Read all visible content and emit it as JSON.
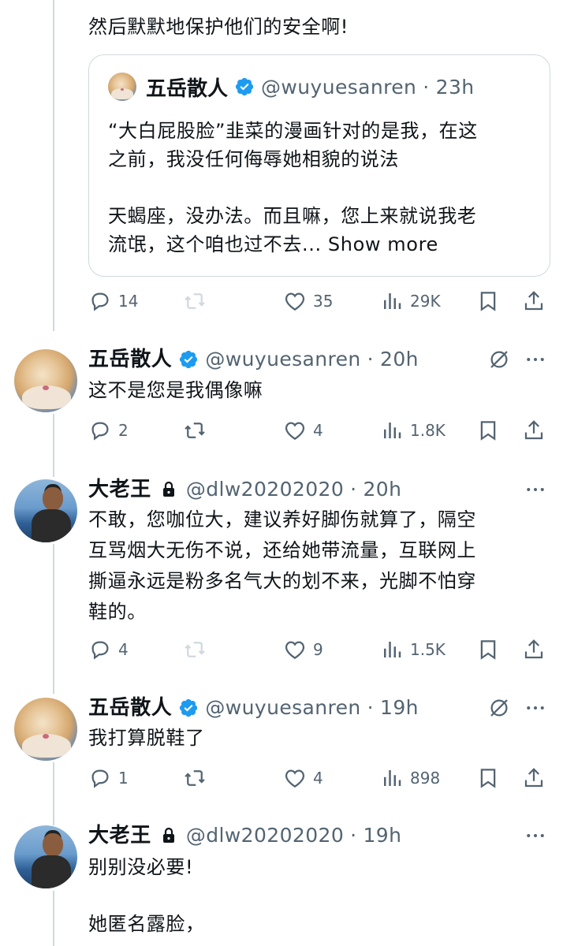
{
  "post0": {
    "text": "然后默默地保护他们的安全啊!",
    "quote": {
      "name": "五岳散人",
      "handle": "@wuyuesanren",
      "sep": "·",
      "time": "23h",
      "lines": [
        "“大白屁股脸”韭菜的漫画针对的是我，在这",
        "之前，我没任何侮辱她相貌的说法",
        "天蝎座，没办法。而且嘛，您上来就说我老",
        "流氓，这个咱也过不去..."
      ],
      "show_more": "Show more"
    },
    "actions": {
      "replies": "14",
      "retweets": "",
      "likes": "35",
      "views": "29K"
    }
  },
  "replies": [
    {
      "name": "五岳散人",
      "handle": "@wuyuesanren",
      "sep": "·",
      "time": "20h",
      "lines": [
        "这不是您是我偶像嘛"
      ],
      "actions": {
        "replies": "2",
        "retweets": "",
        "likes": "4",
        "views": "1.8K"
      }
    },
    {
      "name": "大老王",
      "handle": "@dlw20202020",
      "sep": "·",
      "time": "20h",
      "lines": [
        "不敢，您咖位大，建议养好脚伤就算了，隔空",
        "互骂烟大无伤不说，还给她带流量，互联网上",
        "撕逼永远是粉多名气大的划不来，光脚不怕穿",
        "鞋的。"
      ],
      "actions": {
        "replies": "4",
        "retweets": "",
        "likes": "9",
        "views": "1.5K"
      }
    },
    {
      "name": "五岳散人",
      "handle": "@wuyuesanren",
      "sep": "·",
      "time": "19h",
      "lines": [
        "我打算脱鞋了"
      ],
      "actions": {
        "replies": "1",
        "retweets": "",
        "likes": "4",
        "views": "898"
      }
    },
    {
      "name": "大老王",
      "handle": "@dlw20202020",
      "sep": "·",
      "time": "19h",
      "lines": [
        "别别没必要!",
        "她匿名露脸，"
      ]
    }
  ],
  "colors": {
    "verified": "#1d9bf0",
    "muted": "#536471",
    "border": "#cfd9de"
  },
  "icons": [
    "reply-icon",
    "retweet-icon",
    "like-icon",
    "views-icon",
    "bookmark-icon",
    "share-icon",
    "verified-icon",
    "lock-icon",
    "grok-icon",
    "more-icon"
  ]
}
